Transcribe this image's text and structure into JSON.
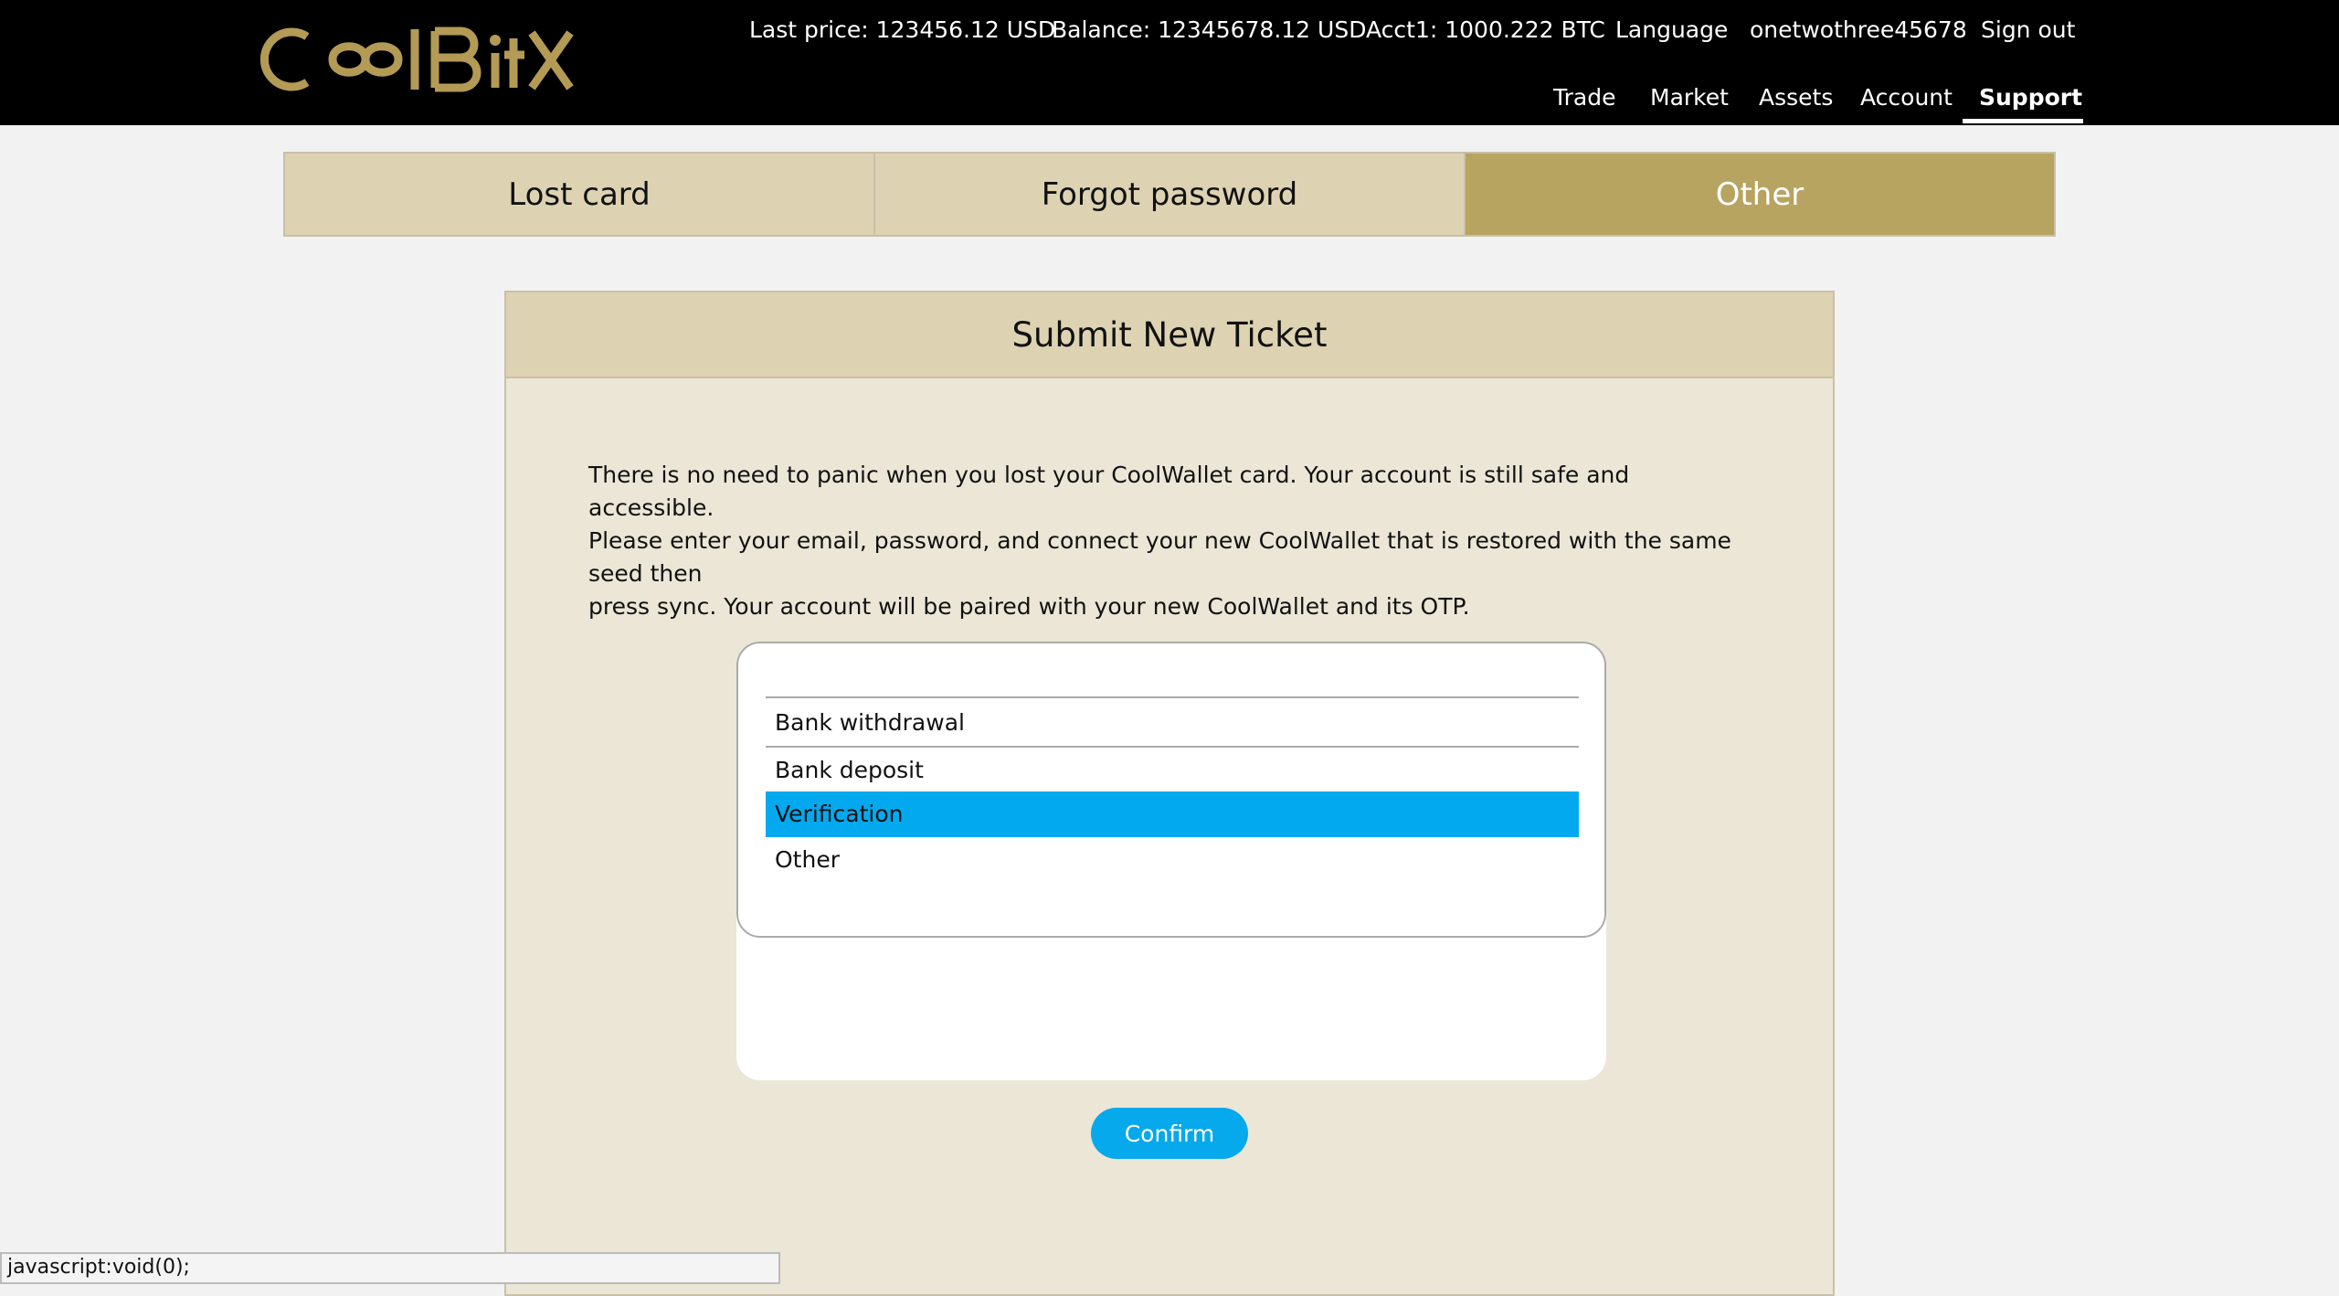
{
  "header": {
    "logo_text": "CoolBitX",
    "last_price": "Last price: 123456.12 USD",
    "balance": "Balance: 12345678.12 USD",
    "account_balance": "Acct1: 1000.222 BTC",
    "language": "Language",
    "username": "onetwothree45678",
    "sign_out": "Sign out",
    "nav": [
      {
        "label": "Trade"
      },
      {
        "label": "Market"
      },
      {
        "label": "Assets"
      },
      {
        "label": "Account"
      },
      {
        "label": "Support"
      }
    ],
    "active_nav": "Support",
    "brand_color": "#b8a461"
  },
  "tabs": [
    {
      "label": "Lost card"
    },
    {
      "label": "Forgot password"
    },
    {
      "label": "Other"
    }
  ],
  "active_tab": "Other",
  "panel": {
    "title": "Submit New Ticket",
    "description_lines": [
      "There is no need to panic when you lost your CoolWallet card. Your account is still safe and accessible.",
      "Please enter your email, password, and connect your new CoolWallet that is restored with the same seed then",
      "press sync. Your account will be paired with your new CoolWallet and its OTP."
    ],
    "options": [
      {
        "label": ""
      },
      {
        "label": "Bank withdrawal"
      },
      {
        "label": "Bank deposit"
      },
      {
        "label": "Verification"
      },
      {
        "label": "Other"
      }
    ],
    "selected_option": "Verification",
    "confirm_label": "Confirm",
    "accent_color": "#03a9ef"
  },
  "status_bar": {
    "text": "javascript:void(0);"
  }
}
